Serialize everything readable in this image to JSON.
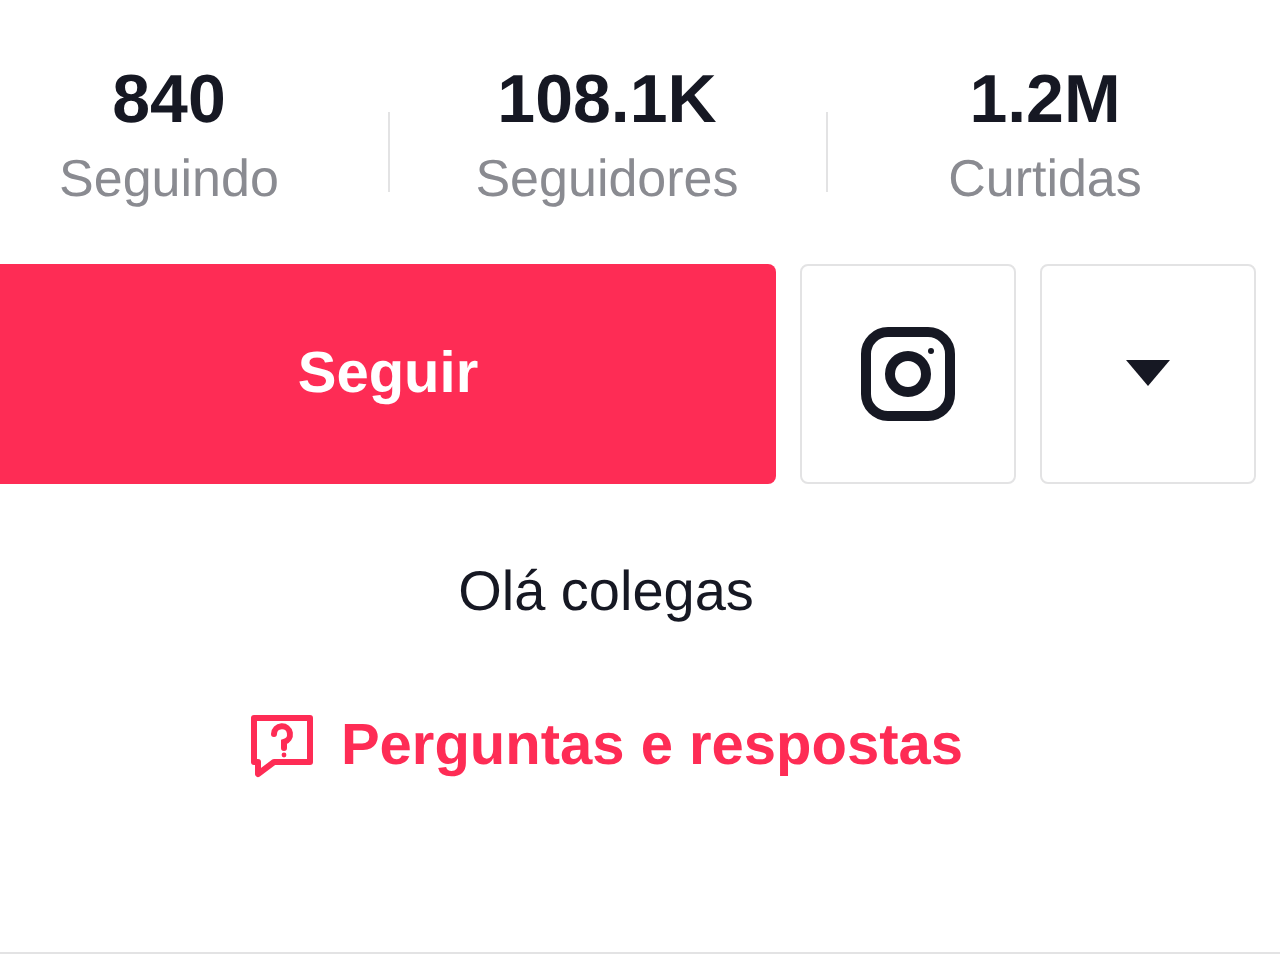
{
  "stats": [
    {
      "value": "840",
      "label": "Seguindo"
    },
    {
      "value": "108.1K",
      "label": "Seguidores"
    },
    {
      "value": "1.2M",
      "label": "Curtidas"
    }
  ],
  "follow_button": {
    "label": "Seguir"
  },
  "bio": "Olá colegas",
  "qa_link": {
    "label": "Perguntas e respostas"
  }
}
